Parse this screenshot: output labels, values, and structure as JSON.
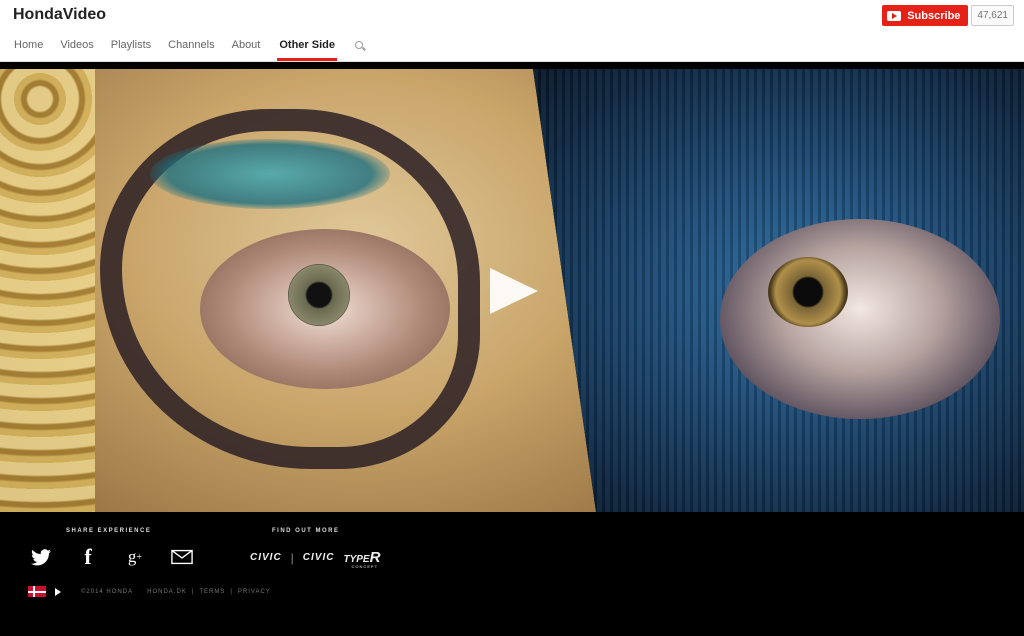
{
  "header": {
    "channel_title": "HondaVideo",
    "subscribe_label": "Subscribe",
    "subscriber_count": "47,621",
    "accent_color": "#e62117"
  },
  "tabs": [
    {
      "label": "Home",
      "active": false
    },
    {
      "label": "Videos",
      "active": false
    },
    {
      "label": "Playlists",
      "active": false
    },
    {
      "label": "Channels",
      "active": false
    },
    {
      "label": "About",
      "active": false
    },
    {
      "label": "Other Side",
      "active": true
    }
  ],
  "search_icon": "search-icon",
  "hero": {
    "play_icon": "play-icon"
  },
  "footer": {
    "share_heading": "SHARE EXPERIENCE",
    "find_heading": "FIND OUT MORE",
    "share_icons": [
      "twitter-icon",
      "facebook-icon",
      "google-plus-icon",
      "mail-icon"
    ],
    "brands": {
      "civic": "CIVIC",
      "civic2": "CIVIC",
      "typer_type": "TYPE",
      "typer_r": "R",
      "typer_concept": "CONCEPT"
    },
    "copyright": "©2014 HONDA",
    "site": "HONDA.DK",
    "terms": "TERMS",
    "privacy": "PRIVACY",
    "separator": "|"
  }
}
